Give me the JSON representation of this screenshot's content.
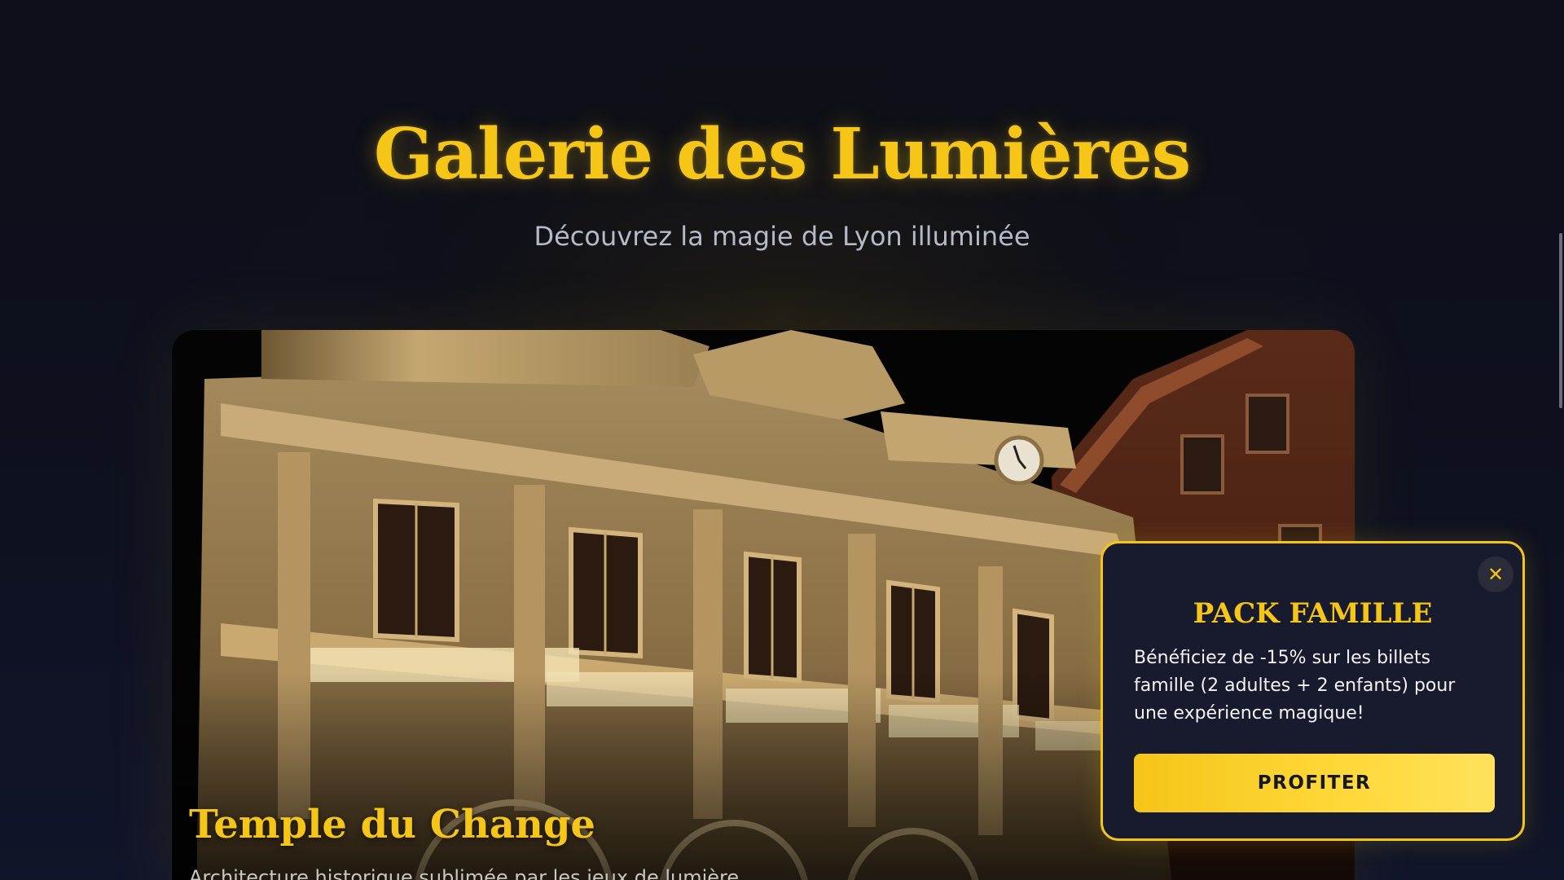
{
  "hero": {
    "title": "Galerie des Lumières",
    "subtitle": "Découvrez la magie de Lyon illuminée"
  },
  "gallery": {
    "current_item": {
      "title": "Temple du Change",
      "description": "Architecture historique sublimée par les jeux de lumière"
    }
  },
  "promo_popup": {
    "title": "PACK FAMILLE",
    "text": "Bénéficiez de -15% sur les billets famille (2 adultes + 2 enfants) pour une expérience magique!",
    "button_label": "PROFITER",
    "close_icon": "close-icon"
  },
  "colors": {
    "accent": "#f5c518",
    "background": "#0c0e18",
    "popup_background": "#181a2e"
  }
}
